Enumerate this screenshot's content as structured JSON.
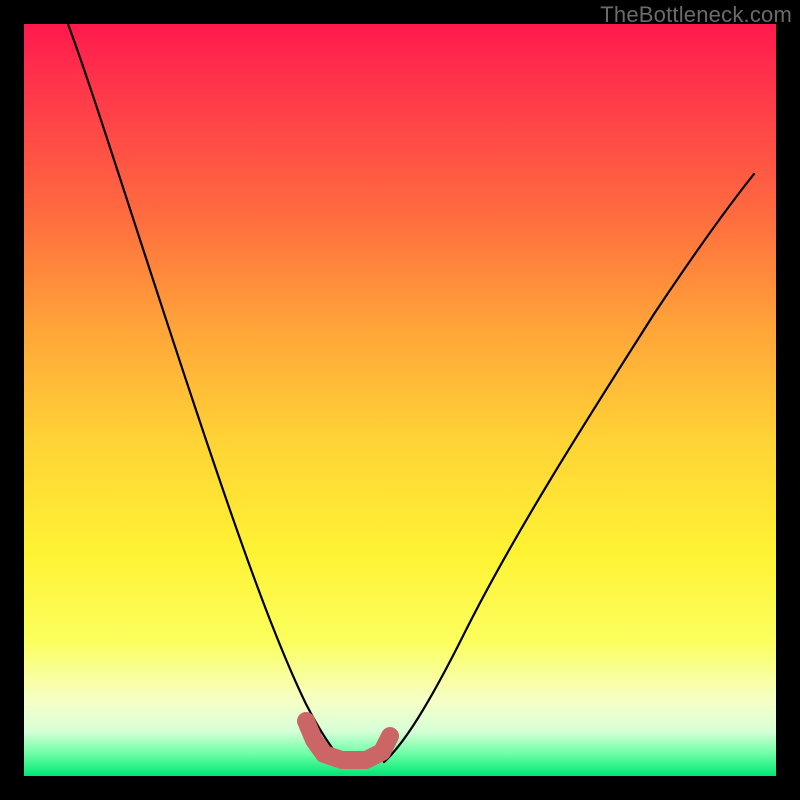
{
  "watermark": "TheBottleneck.com",
  "chart_data": {
    "type": "line",
    "title": "",
    "xlabel": "",
    "ylabel": "",
    "xlim": [
      0,
      100
    ],
    "ylim": [
      0,
      100
    ],
    "annotations": [
      "TheBottleneck.com"
    ],
    "series": [
      {
        "name": "left-curve",
        "x": [
          6,
          10,
          15,
          20,
          25,
          30,
          33,
          36,
          38,
          40
        ],
        "y": [
          100,
          87,
          71,
          55,
          40,
          25,
          15,
          8,
          4,
          2
        ]
      },
      {
        "name": "right-curve",
        "x": [
          48,
          52,
          58,
          65,
          72,
          80,
          88,
          96
        ],
        "y": [
          2,
          6,
          15,
          27,
          39,
          52,
          64,
          75
        ]
      },
      {
        "name": "bottom-blob",
        "x": [
          37,
          39,
          41,
          44,
          47,
          49
        ],
        "y": [
          6,
          3,
          2,
          2,
          3,
          5
        ]
      }
    ],
    "colors": {
      "curve": "#000000",
      "blob": "#cc6666",
      "gradient_top": "#ff1a4d",
      "gradient_bottom": "#00e673"
    }
  }
}
